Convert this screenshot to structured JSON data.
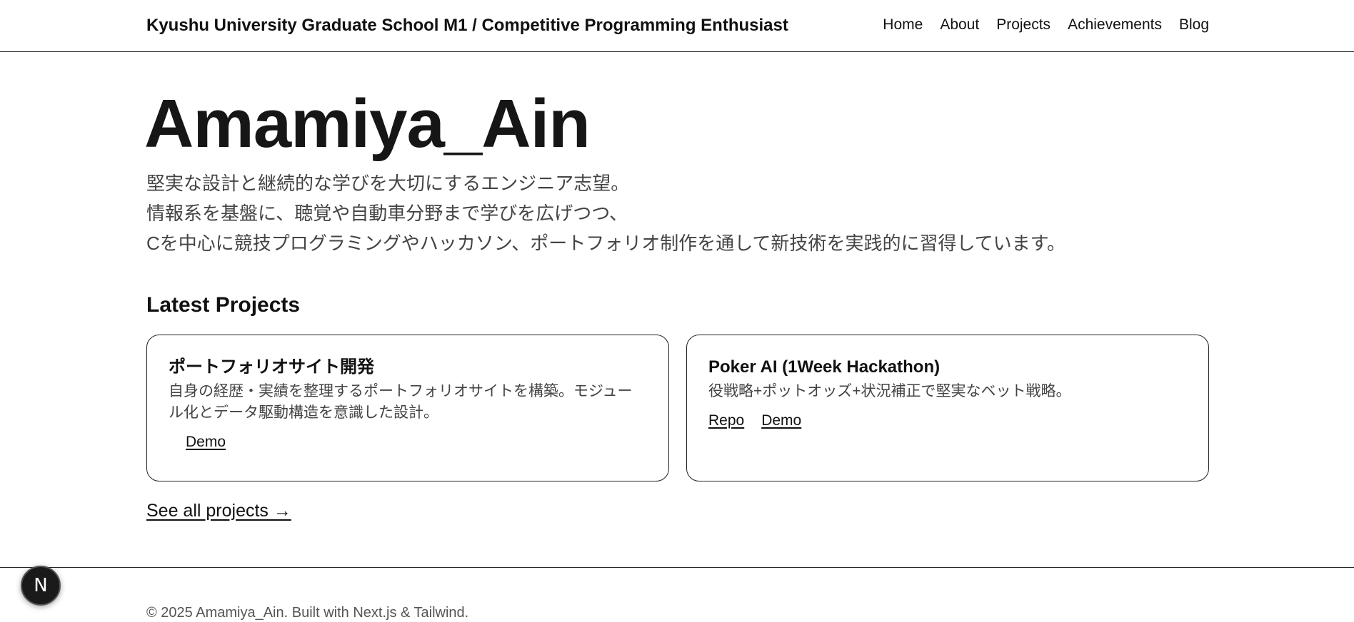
{
  "header": {
    "title": "Kyushu University Graduate School M1 / Competitive Programming Enthusiast",
    "nav": [
      "Home",
      "About",
      "Projects",
      "Achievements",
      "Blog"
    ]
  },
  "hero": {
    "name": "Amamiya_Ain",
    "description": [
      "堅実な設計と継続的な学びを大切にするエンジニア志望。",
      "情報系を基盤に、聴覚や自動車分野まで学びを広げつつ、",
      "Cを中心に競技プログラミングやハッカソン、ポートフォリオ制作を通して新技術を実践的に習得しています。"
    ]
  },
  "latest_projects": {
    "heading": "Latest Projects",
    "projects": [
      {
        "title": "ポートフォリオサイト開発",
        "description": "自身の経歴・実績を整理するポートフォリオサイトを構築。モジュール化とデータ駆動構造を意識した設計。",
        "links": [
          "Demo"
        ]
      },
      {
        "title": "Poker AI (1Week Hackathon)",
        "description": "役戦略+ポットオッズ+状況補正で堅実なベット戦略。",
        "links": [
          "Repo",
          "Demo"
        ]
      }
    ],
    "see_all": "See all projects →"
  },
  "footer": {
    "text": "© 2025 Amamiya_Ain. Built with Next.js & Tailwind."
  },
  "dev_badge": {
    "letter": "N",
    "icon": "nextjs-icon"
  }
}
